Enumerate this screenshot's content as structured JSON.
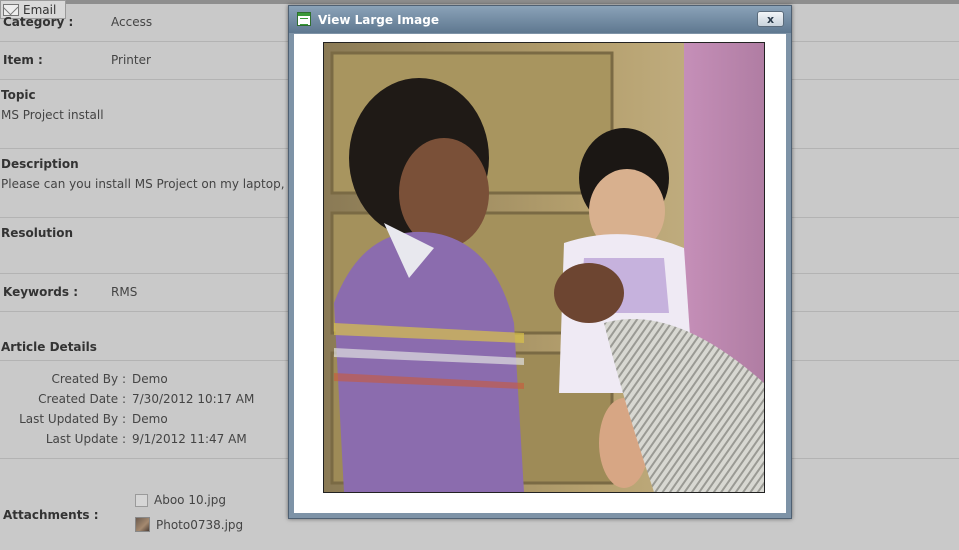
{
  "toolbar": {
    "email_label": "Email"
  },
  "details": {
    "category_label": "Category :",
    "category_value": "Access",
    "item_label": "Item :",
    "item_value": "Printer",
    "topic_label": "Topic",
    "topic_value": "MS Project install",
    "description_label": "Description",
    "description_value": "Please can you install MS Project on my laptop, I h",
    "resolution_label": "Resolution",
    "keywords_label": "Keywords :",
    "keywords_value": "RMS",
    "article_details_label": "Article Details",
    "created_by_label": "Created By :",
    "created_by_value": "Demo",
    "created_date_label": "Created Date :",
    "created_date_value": "7/30/2012 10:17 AM",
    "last_updated_by_label": "Last Updated By :",
    "last_updated_by_value": "Demo",
    "last_update_label": "Last Update :",
    "last_update_value": "9/1/2012 11:47 AM",
    "attachments_label": "Attachments :",
    "attachments": [
      "Aboo 10.jpg",
      "Photo0738.jpg"
    ]
  },
  "modal": {
    "title": "View Large Image",
    "close_label": "x"
  },
  "icons": {
    "email": "envelope-icon",
    "modal": "image-window-icon",
    "file": "file-icon",
    "photo": "photo-thumbnail-icon"
  }
}
